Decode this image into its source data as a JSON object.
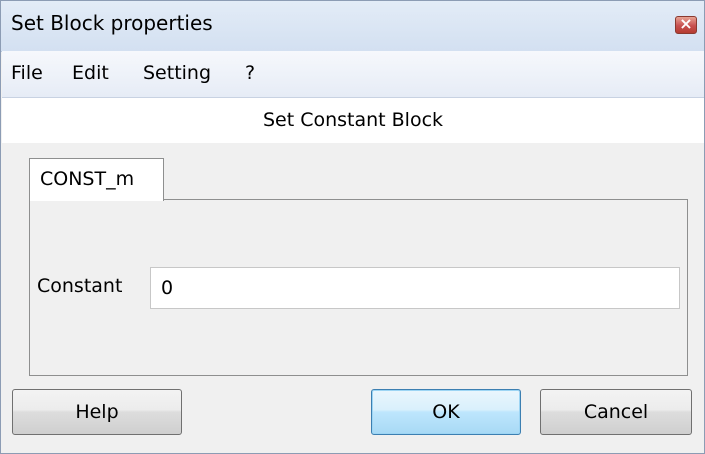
{
  "window": {
    "title": "Set Block properties"
  },
  "menu": {
    "items": [
      "File",
      "Edit",
      "Setting",
      "?"
    ]
  },
  "header": {
    "text": "Set Constant Block"
  },
  "tabs": [
    {
      "label": "CONST_m"
    }
  ],
  "form": {
    "constant_label": "Constant",
    "constant_value": "0"
  },
  "buttons": {
    "help": "Help",
    "ok": "OK",
    "cancel": "Cancel"
  },
  "colors": {
    "titlebar": "#dbe6f4",
    "close_button": "#c75050",
    "ok_button_accent": "#3c7fb1"
  }
}
